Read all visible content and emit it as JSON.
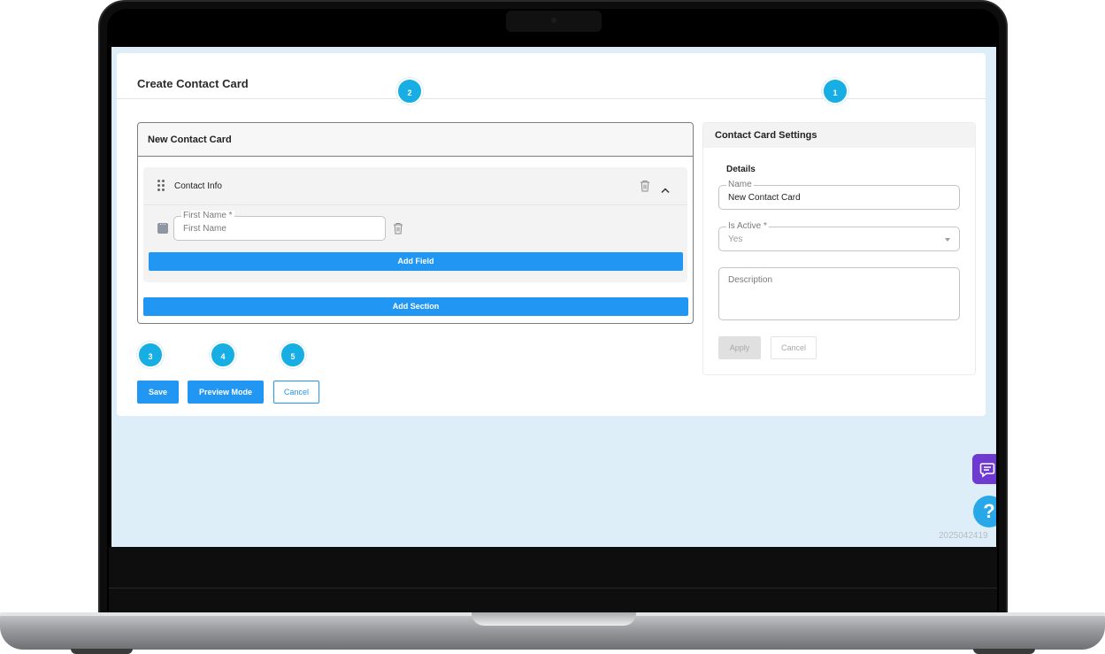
{
  "page": {
    "title": "Create Contact Card"
  },
  "builder": {
    "card_title": "New Contact Card",
    "section": {
      "label": "Contact Info",
      "field": {
        "legend": "First Name *",
        "placeholder": "First Name"
      },
      "add_field_label": "Add Field"
    },
    "add_section_label": "Add Section"
  },
  "actions": {
    "save_label": "Save",
    "preview_label": "Preview Mode",
    "cancel_label": "Cancel"
  },
  "settings": {
    "title": "Contact Card Settings",
    "details_label": "Details",
    "name": {
      "legend": "Name",
      "value": "New Contact Card"
    },
    "is_active": {
      "legend": "Is Active *",
      "value": "Yes"
    },
    "description": {
      "placeholder": "Description"
    },
    "apply_label": "Apply",
    "cancel_label": "Cancel"
  },
  "markers": [
    "1",
    "2",
    "3",
    "4",
    "5"
  ],
  "footer": {
    "build_id": "2025042419"
  },
  "icons": {
    "drag": "drag-handle-icon",
    "delete": "trash-icon",
    "collapse": "chevron-up-icon",
    "field_type": "text-field-icon",
    "dropdown": "dropdown-arrow-icon",
    "chat": "chat-icon",
    "help": "help-icon"
  },
  "colors": {
    "primary": "#2196f3",
    "marker": "#16aee3",
    "screen_background": "#ddeef9",
    "chat_widget": "#6f3ad1",
    "help_widget": "#28a8e8"
  }
}
